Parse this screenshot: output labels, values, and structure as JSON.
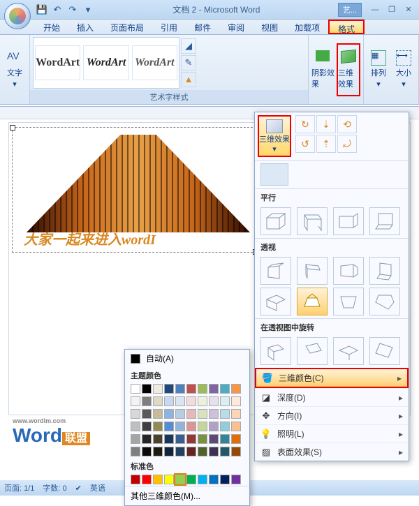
{
  "title": "文档 2 - Microsoft Word",
  "style_badge": "艺...",
  "tabs": [
    "开始",
    "插入",
    "页面布局",
    "引用",
    "邮件",
    "审阅",
    "视图",
    "加载项",
    "格式"
  ],
  "ribbon": {
    "text_btn": "文字",
    "wordart_gallery_label": "艺术字样式",
    "shadow_btn": "阴影效果",
    "threed_btn": "三维效果",
    "arrange_btn": "排列",
    "size_btn": "大小",
    "wa_sample": "WordArt"
  },
  "dropdown": {
    "threed_btn": "三维效果",
    "no3d_section": "",
    "parallel": "平行",
    "perspective": "透视",
    "rotate_in_persp": "在透视图中旋转",
    "menu": {
      "color": "三维颜色(C)",
      "depth": "深度(D)",
      "direction": "方向(I)",
      "lighting": "照明(L)",
      "surface": "表面效果(S)"
    }
  },
  "color_picker": {
    "auto": "自动(A)",
    "theme": "主题颜色",
    "standard": "标准色",
    "more": "其他三维颜色(M)...",
    "theme_row1": [
      "#ffffff",
      "#000000",
      "#eeece1",
      "#1f497d",
      "#4f81bd",
      "#c0504d",
      "#9bbb59",
      "#8064a2",
      "#4bacc6",
      "#f79646"
    ],
    "theme_shades": [
      [
        "#f2f2f2",
        "#7f7f7f",
        "#ddd9c3",
        "#c6d9f0",
        "#dbe5f1",
        "#f2dcdb",
        "#ebf1dd",
        "#e5e0ec",
        "#dbeef3",
        "#fdeada"
      ],
      [
        "#d8d8d8",
        "#595959",
        "#c4bd97",
        "#8db3e2",
        "#b8cce4",
        "#e5b9b7",
        "#d7e3bc",
        "#ccc1d9",
        "#b7dde8",
        "#fbd5b5"
      ],
      [
        "#bfbfbf",
        "#3f3f3f",
        "#938953",
        "#548dd4",
        "#95b3d7",
        "#d99694",
        "#c3d69b",
        "#b2a1c7",
        "#92cddc",
        "#fac08f"
      ],
      [
        "#a5a5a5",
        "#262626",
        "#494429",
        "#17365d",
        "#366092",
        "#953734",
        "#76923c",
        "#5f497a",
        "#31859b",
        "#e36c09"
      ],
      [
        "#7f7f7f",
        "#0c0c0c",
        "#1d1b10",
        "#0f243e",
        "#244061",
        "#632423",
        "#4f6128",
        "#3f3151",
        "#205867",
        "#974806"
      ]
    ],
    "standard_colors": [
      "#c00000",
      "#ff0000",
      "#ffc000",
      "#ffff00",
      "#92d050",
      "#00b050",
      "#00b0f0",
      "#0070c0",
      "#002060",
      "#7030a0"
    ]
  },
  "wordart_text": "大家一起来进入wordI",
  "status": {
    "page": "页面: 1/1",
    "words": "字数: 0",
    "lang": "英语"
  },
  "logo": {
    "brand": "Word",
    "url": "www.wordlm.com",
    "suffix": "联盟"
  }
}
